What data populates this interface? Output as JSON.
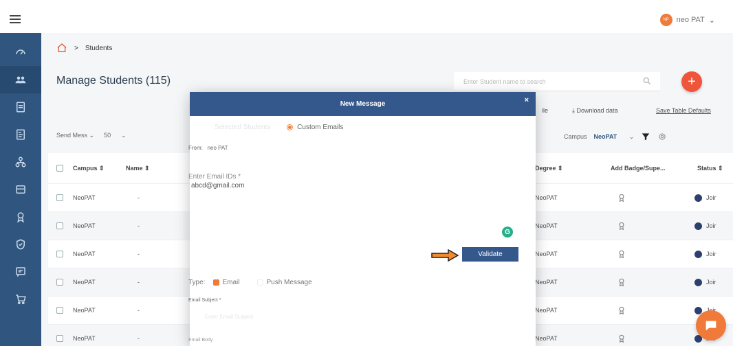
{
  "header": {
    "user_name": "neo PAT",
    "avatar_initials": "NP"
  },
  "sidebar": {
    "items": [
      {
        "icon": "speedometer-icon",
        "active": false
      },
      {
        "icon": "students-icon",
        "active": true
      },
      {
        "icon": "document-icon",
        "active": false
      },
      {
        "icon": "report-icon",
        "active": false
      },
      {
        "icon": "org-chart-icon",
        "active": false
      },
      {
        "icon": "database-icon",
        "active": false
      },
      {
        "icon": "award-icon",
        "active": false
      },
      {
        "icon": "shield-icon",
        "active": false
      },
      {
        "icon": "chat-list-icon",
        "active": false
      },
      {
        "icon": "cart-icon",
        "active": false
      }
    ]
  },
  "breadcrumb": {
    "separator": ">",
    "current": "Students"
  },
  "page": {
    "title": "Manage Students (115)",
    "search_placeholder": "Enter Student name to search"
  },
  "actions": {
    "upload": "ile",
    "download": "⤓ Download data",
    "save_defaults": "Save Table Defaults"
  },
  "toolbar": {
    "send_message": "Send Mess",
    "page_size": "50",
    "campus_label": "Campus",
    "campus_value": "NeoPAT"
  },
  "table": {
    "columns": {
      "campus": "Campus ⇕",
      "name": "Name ⇕",
      "degree": "Degree ⇕",
      "badge": "Add Badge/Supe...",
      "status": "Status ⇕"
    },
    "rows": [
      {
        "campus": "NeoPAT",
        "name": "-",
        "degree": "NeoPAT",
        "status": "Joir"
      },
      {
        "campus": "NeoPAT",
        "name": "-",
        "degree": "NeoPAT",
        "status": "Joir"
      },
      {
        "campus": "NeoPAT",
        "name": "-",
        "degree": "NeoPAT",
        "status": "Joir"
      },
      {
        "campus": "NeoPAT",
        "name": "-",
        "degree": "NeoPAT",
        "status": "Joir"
      },
      {
        "campus": "NeoPAT",
        "name": "-",
        "degree": "NeoPAT",
        "status": "Joir"
      },
      {
        "campus": "NeoPAT",
        "name": "-",
        "degree": "NeoPAT",
        "status": "Joir"
      }
    ]
  },
  "modal": {
    "title": "New Message",
    "close": "×",
    "option_students": "Selected Students",
    "option_custom": "Custom Emails",
    "from_label": "From:",
    "from_value": "neo PAT",
    "emails_label": "Enter Email IDs *",
    "emails_value": "abcd@gmail.com",
    "grammar_badge": "G",
    "validate": "Validate",
    "type_label": "Type:",
    "type_email": "Email",
    "type_push": "Push Message",
    "subject_label": "Email Subject *",
    "subject_placeholder": "Enter Email Subject",
    "body_label": "Email Body"
  },
  "colors": {
    "sidebar": "#30567f",
    "modal_header": "#35588c",
    "accent": "#f07a3a",
    "fab": "#f0543a"
  }
}
